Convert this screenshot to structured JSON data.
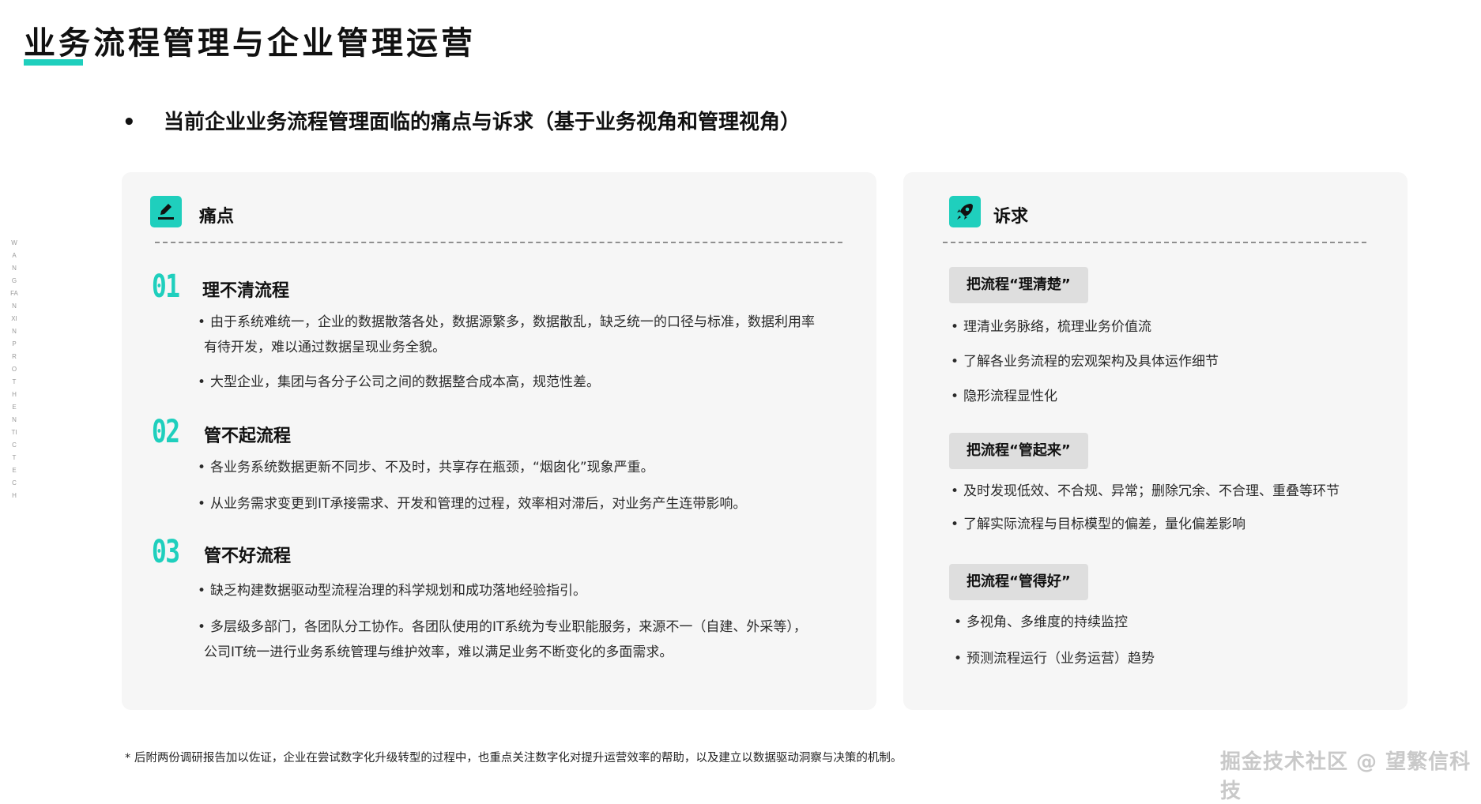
{
  "page": {
    "title": "业务流程管理与企业管理运营",
    "vertical_tag": "WANGFANXIN PROTHENTIC TECH",
    "subtitle_bullet": "•",
    "subtitle": "当前企业业务流程管理面临的痛点与诉求（基于业务视角和管理视角）"
  },
  "pain_points": {
    "heading": "痛点",
    "icon": "edit-icon",
    "sections": [
      {
        "number": "01",
        "title": "理不清流程",
        "bullets": [
          "由于系统难统一，企业的数据散落各处，数据源繁多，数据散乱，缺乏统一的口径与标准，数据利用率",
          "有待开发，难以通过数据呈现业务全貌。",
          "大型企业，集团与各分子公司之间的数据整合成本高，规范性差。"
        ]
      },
      {
        "number": "02",
        "title": "管不起流程",
        "bullets": [
          "各业务系统数据更新不同步、不及时，共享存在瓶颈，“烟囱化”现象严重。",
          "从业务需求变更到IT承接需求、开发和管理的过程，效率相对滞后，对业务产生连带影响。"
        ]
      },
      {
        "number": "03",
        "title": "管不好流程",
        "bullets": [
          "缺乏构建数据驱动型流程治理的科学规划和成功落地经验指引。",
          "多层级多部门，各团队分工协作。各团队使用的IT系统为专业职能服务，来源不一（自建、外采等），",
          "公司IT统一进行业务系统管理与维护效率，难以满足业务不断变化的多面需求。"
        ]
      }
    ]
  },
  "demands": {
    "heading": "诉求",
    "icon": "rocket-icon",
    "groups": [
      {
        "tag": "把流程“理清楚”",
        "bullets": [
          "理清业务脉络，梳理业务价值流",
          "了解各业务流程的宏观架构及具体运作细节",
          "隐形流程显性化"
        ]
      },
      {
        "tag": "把流程“管起来”",
        "bullets": [
          "及时发现低效、不合规、异常；删除冗余、不合理、重叠等环节",
          "了解实际流程与目标模型的偏差，量化偏差影响"
        ]
      },
      {
        "tag": "把流程“管得好”",
        "bullets": [
          "多视角、多维度的持续监控",
          "预测流程运行（业务运营）趋势"
        ]
      }
    ]
  },
  "footnote": "* 后附两份调研报告加以佐证，企业在尝试数字化升级转型的过程中，也重点关注数字化对提升运营效率的帮助，以及建立以数据驱动洞察与决策的机制。",
  "watermark": "掘金技术社区 @ 望繁信科技",
  "colors": {
    "accent": "#1fcfbd",
    "card_bg": "#f6f6f6",
    "tag_bg": "#dedede"
  }
}
